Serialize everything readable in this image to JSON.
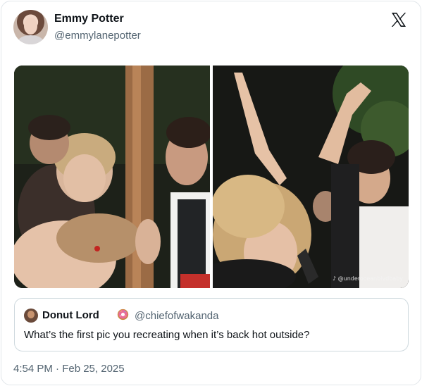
{
  "author": {
    "display_name": "Emmy Potter",
    "handle": "@emmylanepotter"
  },
  "platform_logo": "x-logo-icon",
  "media": {
    "watermark": "♪ @underoceanblvdbaby"
  },
  "quoted_post": {
    "display_name": "Donut Lord",
    "emoji": "doughnut-icon",
    "handle": "@chiefofwakanda",
    "text": "What’s the first pic you recreating when it’s back hot outside?"
  },
  "timestamp": "4:54 PM · Feb 25, 2025"
}
